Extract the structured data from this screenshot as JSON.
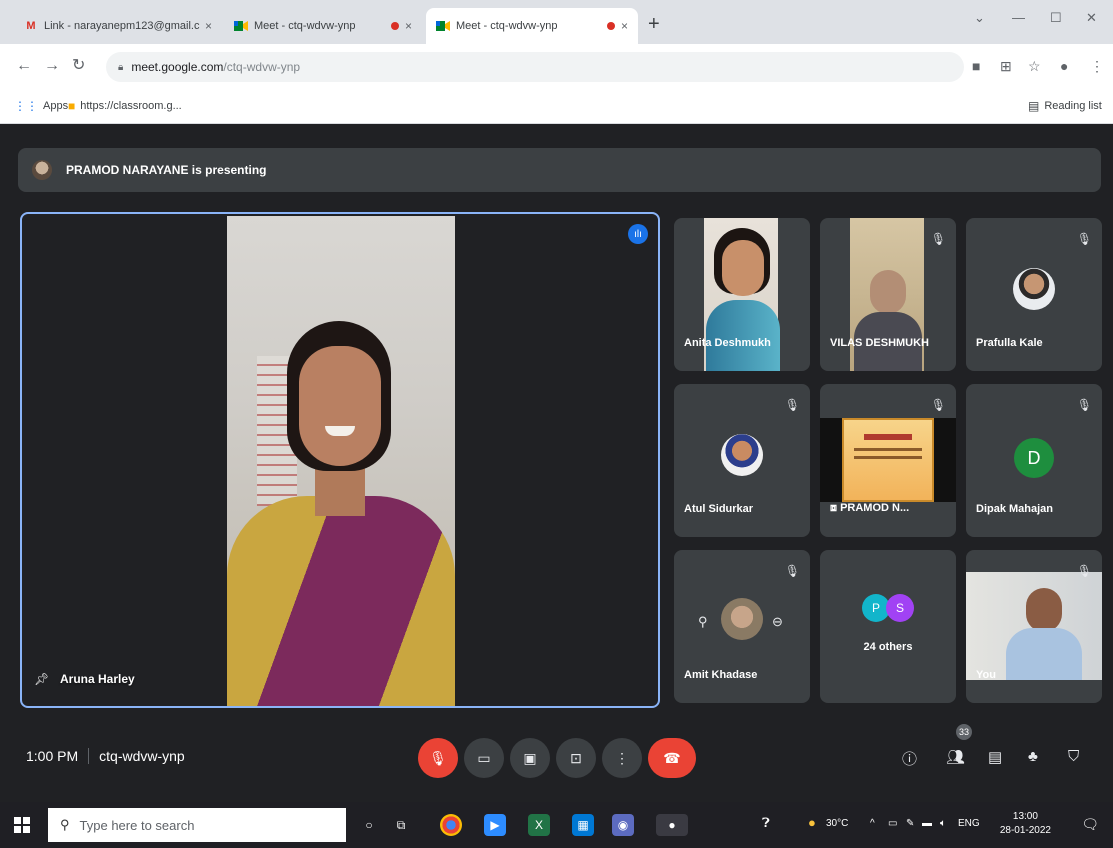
{
  "browser": {
    "tabs": [
      {
        "icon": "gmail-icon",
        "label": "Link - narayanepm123@gmail.c",
        "active": false,
        "recording": false
      },
      {
        "icon": "meet-icon",
        "label": "Meet - ctq-wdvw-ynp",
        "active": false,
        "recording": true
      },
      {
        "icon": "meet-icon",
        "label": "Meet - ctq-wdvw-ynp",
        "active": true,
        "recording": true
      }
    ],
    "url_host": "meet.google.com",
    "url_path": "/ctq-wdvw-ynp",
    "bookmarks": {
      "apps_label": "Apps",
      "classroom_label": "https://classroom.g...",
      "reading_list_label": "Reading list"
    }
  },
  "meet": {
    "presenting_banner": "PRAMOD NARAYANE is presenting",
    "main_participant": "Aruna Harley",
    "participants": [
      {
        "name": "Anita Deshmukh",
        "type": "video"
      },
      {
        "name": "VILAS DESHMUKH",
        "type": "video"
      },
      {
        "name": "Prafulla Kale",
        "type": "photo"
      },
      {
        "name": "Atul Sidurkar",
        "type": "photo"
      },
      {
        "name": "PRAMOD N...",
        "type": "screen"
      },
      {
        "name": "Dipak Mahajan",
        "type": "letter",
        "letter": "D"
      },
      {
        "name": "Amit Khadase",
        "type": "photo"
      },
      {
        "name": "24 others",
        "type": "others",
        "letters": [
          "P",
          "S"
        ]
      },
      {
        "name": "You",
        "type": "video"
      }
    ],
    "controls": {
      "time": "1:00 PM",
      "meeting_code": "ctq-wdvw-ynp",
      "participant_count": "33"
    }
  },
  "taskbar": {
    "search_placeholder": "Type here to search",
    "temperature": "30°C",
    "language": "ENG",
    "time": "13:00",
    "date": "28-01-2022"
  },
  "colors": {
    "meet_bg": "#202124",
    "tile_bg": "#3c4043",
    "active_speaker_border": "#8ab4f8",
    "end_call_red": "#ea4335"
  }
}
